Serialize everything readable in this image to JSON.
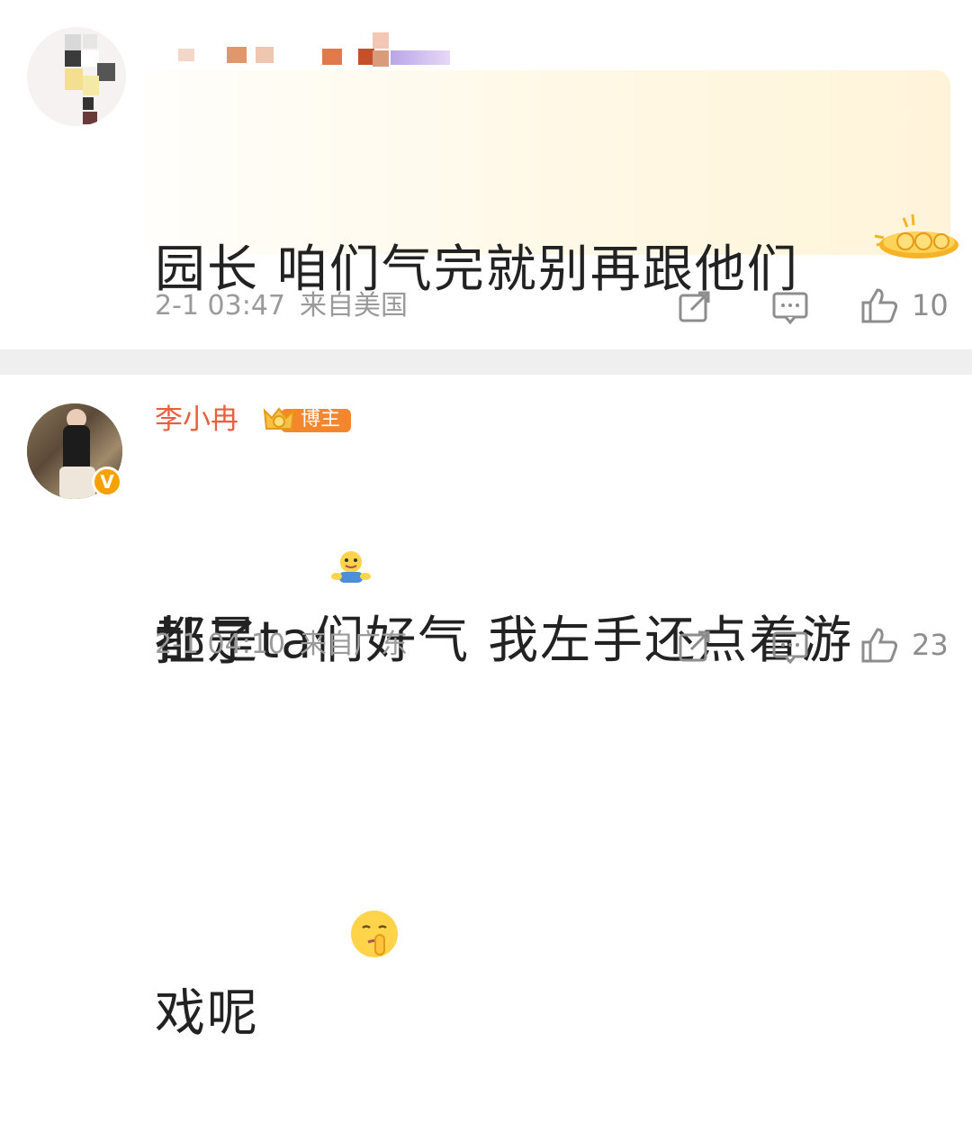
{
  "comments": [
    {
      "username": "",
      "text_line1": "园长 咱们气完就别再跟他们",
      "text_line2": "扯了",
      "emoji": "hug-emoji",
      "time": "2-1 03:47",
      "location": "来自美国",
      "likes": "10",
      "sticker": "coins-sticker"
    },
    {
      "username": "李小冉",
      "badge_label": "博主",
      "text_line1": "都是ta们好气 我左手还点着游",
      "text_line2": "戏呢",
      "emoji": "shush-emoji",
      "time": "2-1 04:10",
      "location": "来自广东",
      "likes": "23",
      "verified": "V"
    }
  ],
  "colors": {
    "username": "#e6603d",
    "meta": "#9a9a9a",
    "divider": "#efefef",
    "badge": "#f5a100"
  }
}
